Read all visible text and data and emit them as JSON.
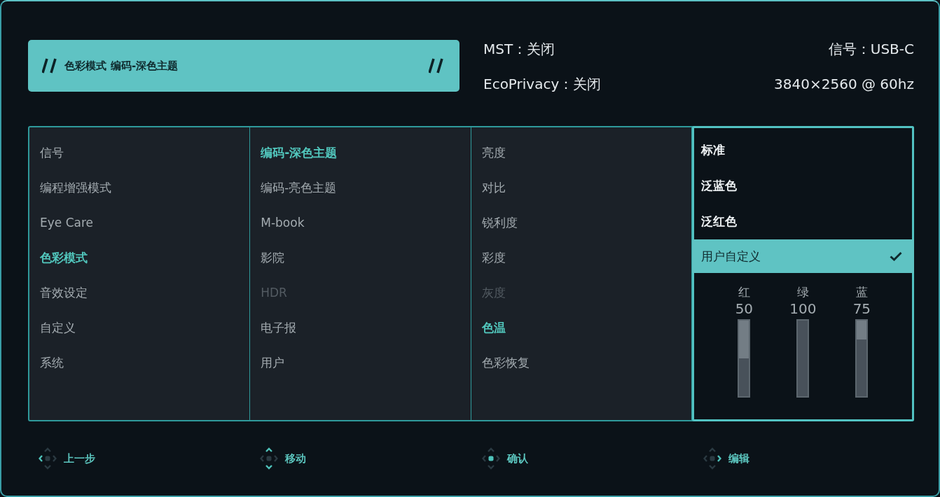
{
  "banner": {
    "section": "色彩模式",
    "mode": "编码-深色主题"
  },
  "status_left": [
    "MST：关闭",
    "EcoPrivacy：关闭"
  ],
  "status_right": [
    "信号：USB-C",
    "3840×2560 @ 60hz"
  ],
  "menu": {
    "columns": [
      {
        "items": [
          {
            "label": "信号",
            "selected": false,
            "disabled": false
          },
          {
            "label": "编程增强模式",
            "selected": false,
            "disabled": false
          },
          {
            "label": "Eye Care",
            "selected": false,
            "disabled": false
          },
          {
            "label": "色彩模式",
            "selected": true,
            "disabled": false
          },
          {
            "label": "音效设定",
            "selected": false,
            "disabled": false
          },
          {
            "label": "自定义",
            "selected": false,
            "disabled": false
          },
          {
            "label": "系统",
            "selected": false,
            "disabled": false
          }
        ]
      },
      {
        "items": [
          {
            "label": "编码-深色主题",
            "selected": true,
            "disabled": false
          },
          {
            "label": "编码-亮色主题",
            "selected": false,
            "disabled": false
          },
          {
            "label": "M-book",
            "selected": false,
            "disabled": false
          },
          {
            "label": "影院",
            "selected": false,
            "disabled": false
          },
          {
            "label": "HDR",
            "selected": false,
            "disabled": true
          },
          {
            "label": "电子报",
            "selected": false,
            "disabled": false
          },
          {
            "label": "用户",
            "selected": false,
            "disabled": false
          }
        ]
      },
      {
        "items": [
          {
            "label": "亮度",
            "selected": false,
            "disabled": false
          },
          {
            "label": "对比",
            "selected": false,
            "disabled": false
          },
          {
            "label": "锐利度",
            "selected": false,
            "disabled": false
          },
          {
            "label": "彩度",
            "selected": false,
            "disabled": false
          },
          {
            "label": "灰度",
            "selected": false,
            "disabled": true
          },
          {
            "label": "色温",
            "selected": true,
            "disabled": false
          },
          {
            "label": "色彩恢复",
            "selected": false,
            "disabled": false
          }
        ]
      }
    ]
  },
  "options": {
    "items": [
      {
        "label": "标准",
        "selected": false
      },
      {
        "label": "泛蓝色",
        "selected": false
      },
      {
        "label": "泛红色",
        "selected": false
      },
      {
        "label": "用户自定义",
        "selected": true
      }
    ],
    "sliders": [
      {
        "label": "红",
        "value": "50",
        "level": 0.5
      },
      {
        "label": "绿",
        "value": "100",
        "level": 1
      },
      {
        "label": "蓝",
        "value": "75",
        "level": 0.75
      }
    ]
  },
  "hints": [
    {
      "kind": "left",
      "label": "上一步"
    },
    {
      "kind": "up-down",
      "label": "移动"
    },
    {
      "kind": "center",
      "label": "确认"
    },
    {
      "kind": "right",
      "label": "编辑"
    }
  ]
}
